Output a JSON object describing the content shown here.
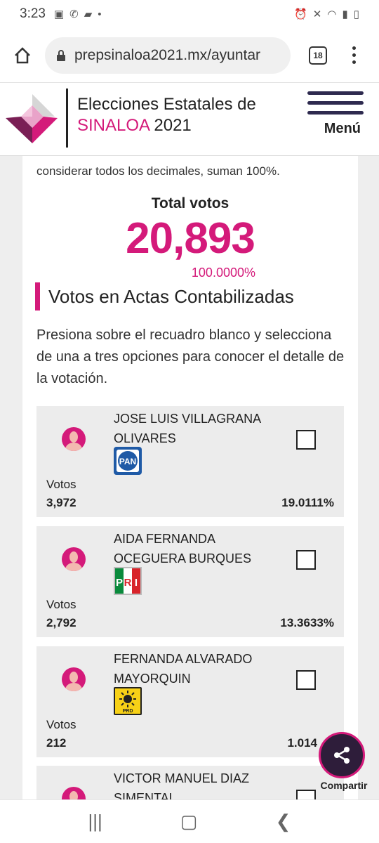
{
  "status": {
    "time": "3:23"
  },
  "browser": {
    "url": "prepsinaloa2021.mx/ayuntar",
    "tab_count": "18"
  },
  "header": {
    "title_line1": "Elecciones Estatales de",
    "title_pink": "SINALOA",
    "title_year": " 2021",
    "menu_label": "Menú"
  },
  "summary": {
    "cut_text": "considerar todos los decimales, suman 100%.",
    "total_label": "Total votos",
    "total_value": "20,893",
    "total_pct": "100.0000%"
  },
  "section": {
    "title": "Votos en Actas Contabilizadas",
    "instructions": "Presiona sobre el recuadro blanco y selecciona de una a tres opciones para conocer el detalle de la votación."
  },
  "candidates": [
    {
      "name": "JOSE LUIS VILLAGRANA OLIVARES",
      "party": "PAN",
      "votes_label": "Votos",
      "votes": "3,972",
      "pct": "19.0111%"
    },
    {
      "name": "AIDA FERNANDA OCEGUERA BURQUES",
      "party": "PRI",
      "votes_label": "Votos",
      "votes": "2,792",
      "pct": "13.3633%"
    },
    {
      "name": "FERNANDA ALVARADO MAYORQUIN",
      "party": "PRD",
      "votes_label": "Votos",
      "votes": "212",
      "pct": "1.014"
    },
    {
      "name": "VICTOR MANUEL DIAZ SIMENTAL",
      "party": "",
      "votes_label": "",
      "votes": "",
      "pct": ""
    }
  ],
  "share": {
    "label": "Compartir"
  }
}
